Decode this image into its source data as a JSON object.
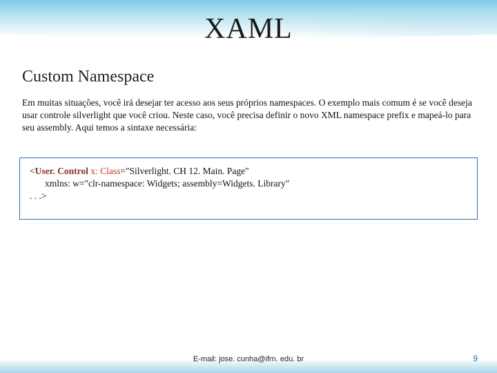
{
  "slide": {
    "title": "XAML",
    "section": "Custom Namespace",
    "body": "Em muitas situações, você irá desejar ter acesso aos seus próprios namespaces. O exemplo mais comum é se você deseja usar controle silverlight que você criou. Neste caso, você precisa definir o novo XML namespace prefix e mapeá-lo para seu assembly. Aqui temos a sintaxe necessária:"
  },
  "code": {
    "open_bracket": "<",
    "element": "User. Control",
    "attr1_name": " x: Class",
    "eq1": "=",
    "attr1_val": "\"Silverlight. CH 12. Main. Page\"",
    "line2_attr": "xmlns: w",
    "line2_eq": "=",
    "line2_val": "\"clr-namespace: Widgets; assembly=Widgets. Library\"",
    "end": ". . .>"
  },
  "footer": {
    "email": "E-mail: jose. cunha@ifrn. edu. br",
    "page": "9"
  }
}
